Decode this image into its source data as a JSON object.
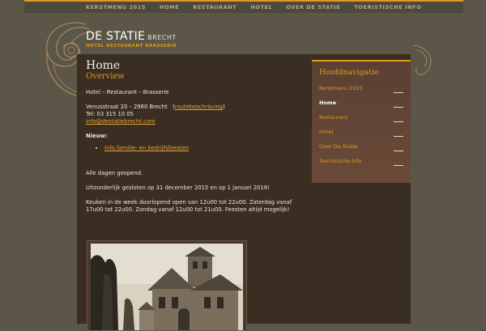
{
  "topnav": [
    "KERSTMENU 2015",
    "HOME",
    "RESTAURANT",
    "HOTEL",
    "OVER DE STATIE",
    "TOERISTISCHE INFO"
  ],
  "logo": {
    "main_bold": "DE STATIE",
    "main_sub": "BRECHT",
    "tagline": "HOTEL  RESTAURANT  BRASSERIE"
  },
  "page": {
    "title": "Home",
    "subtitle": "Overview"
  },
  "content": {
    "line1": "Hotel – Restaurant – Brasserie",
    "address": "Venusstraat 20 – 2960 Brecht",
    "route_link": "routebeschrijving",
    "phone": "Tel: 03 315 10 05",
    "email": "info@destatiebrecht.com",
    "news_label": "Nieuw:",
    "news_item": "Info familie- en bedrijfsfeesten",
    "open": "Alle dagen geopend.",
    "closed": "Uitzonderlijk gesloten op 31 december 2015 en op 1 januari 2016!",
    "hours": "Keuken in de week doorlopend open van 12u00 tot 22u00.  Zaterdag vanaf 17u00 tot 22u00. Zondag vanaf 12u00 tot 21u00. Feesten altijd mogelijk!"
  },
  "sidebar": {
    "title": "Hoofdnavigatie",
    "items": [
      "Kerstmenu 2015",
      "Home",
      "Restaurant",
      "Hotel",
      "Over De Statie",
      "Toeristische Info"
    ]
  },
  "colors": {
    "accent": "#e09a1c",
    "background": "#5b5648",
    "panel": "#3a2d21"
  }
}
